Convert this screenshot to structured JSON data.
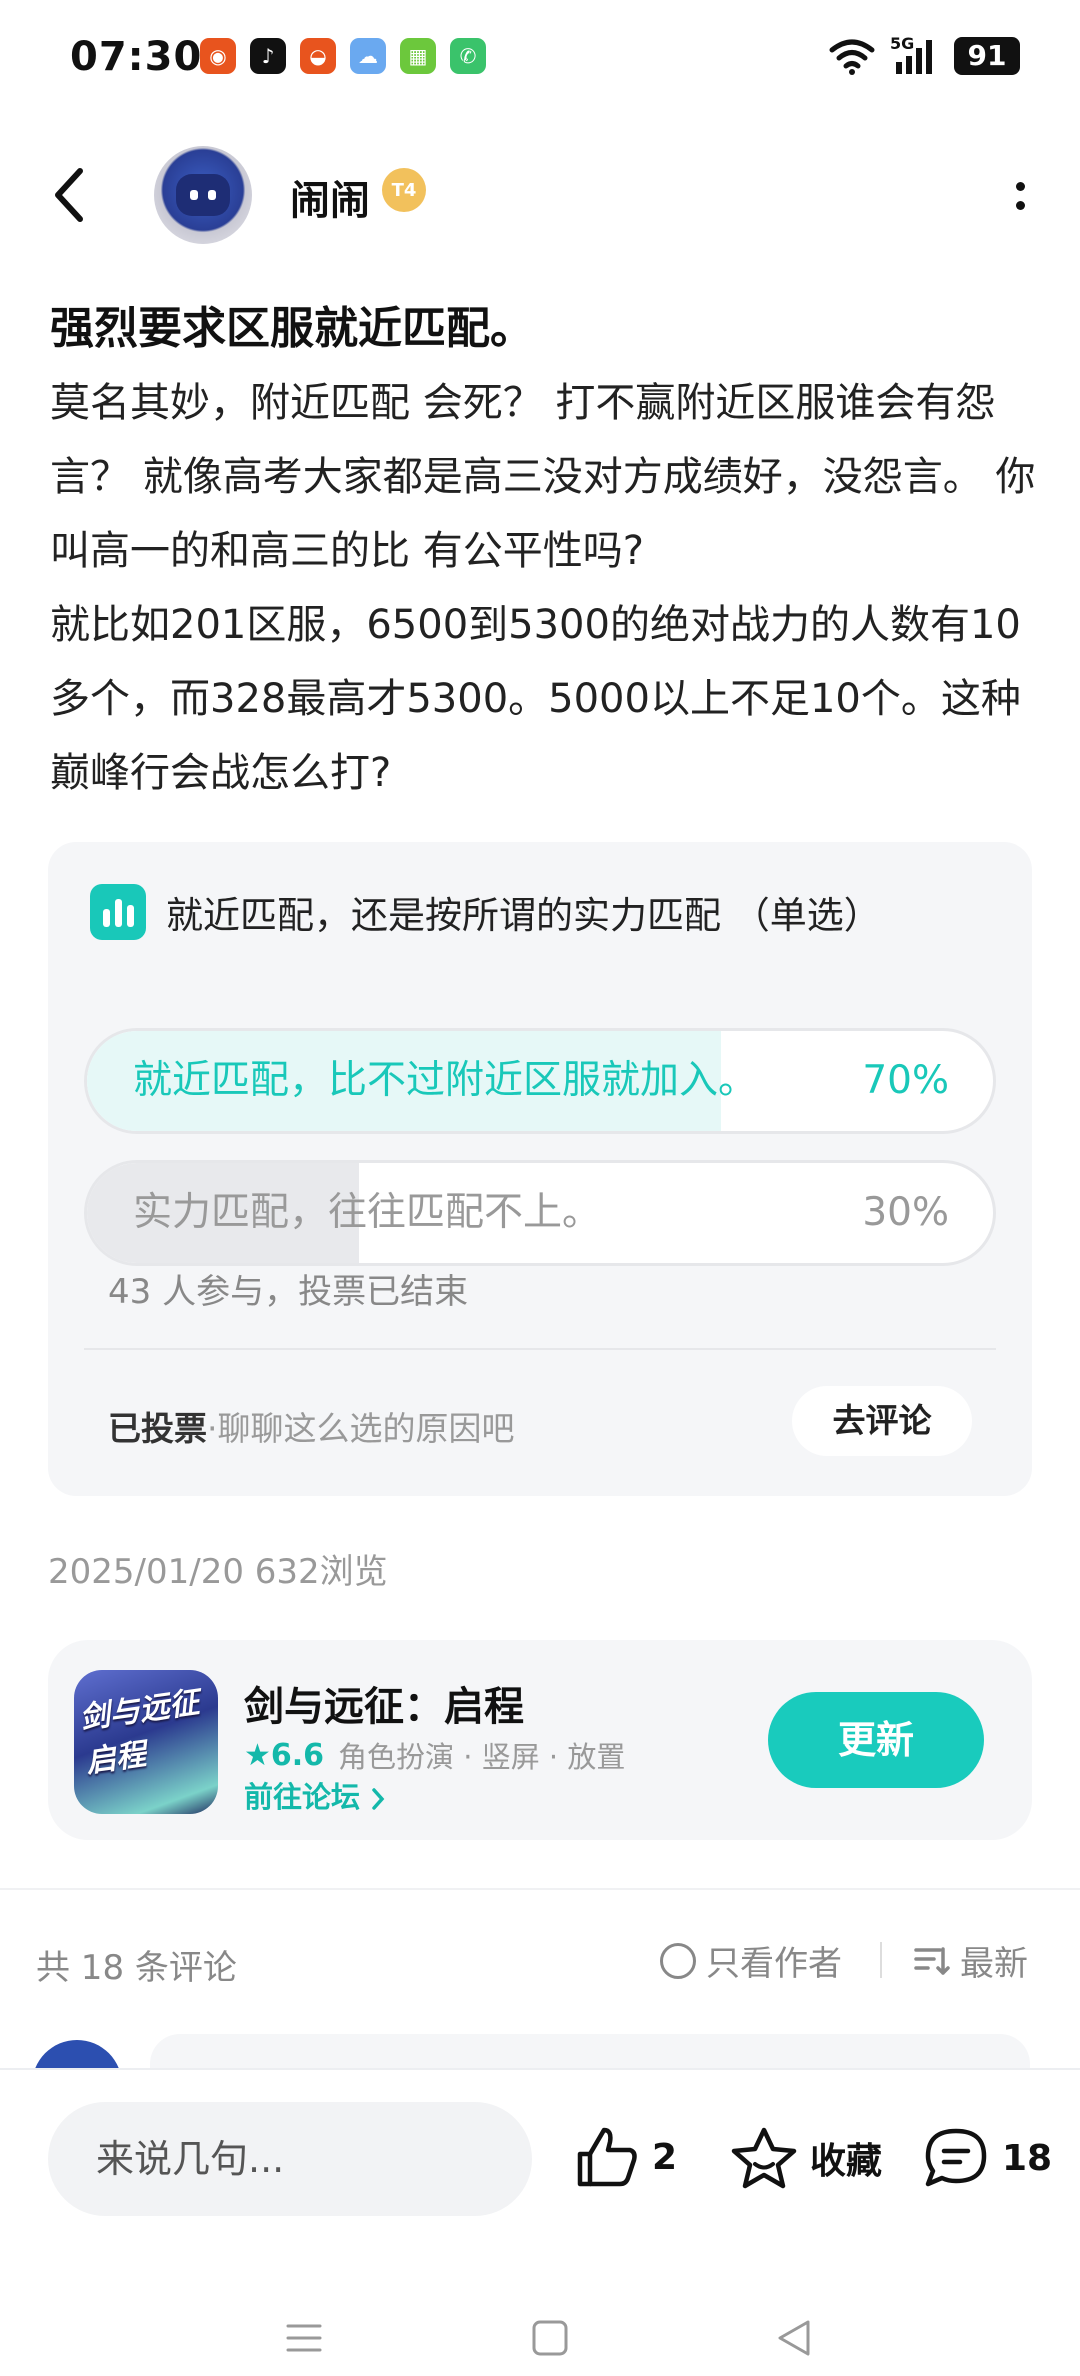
{
  "status_bar": {
    "time": "07:30",
    "network": "5G",
    "battery": "91",
    "notification_icons": [
      {
        "name": "weibo-icon",
        "color": "#e8541e",
        "glyph": "◉"
      },
      {
        "name": "tiktok-icon",
        "color": "#111111",
        "glyph": "♪"
      },
      {
        "name": "app-icon",
        "color": "#e8541e",
        "glyph": "◒"
      },
      {
        "name": "weather-icon",
        "color": "#6aa9f0",
        "glyph": "☁"
      },
      {
        "name": "app-icon",
        "color": "#6cc83c",
        "glyph": "▦"
      },
      {
        "name": "phone-icon",
        "color": "#3ac36b",
        "glyph": "✆"
      }
    ]
  },
  "header": {
    "username": "闹闹",
    "level_badge": "T4"
  },
  "post": {
    "title": "强烈要求区服就近匹配。",
    "paragraphs": [
      "莫名其妙，附近匹配 会死？ 打不赢附近区服谁会有怨言？ 就像高考大家都是高三没对方成绩好，没怨言。 你叫高一的和高三的比 有公平性吗?",
      "就比如201区服，6500到5300的绝对战力的人数有10多个，而328最高才5300。5000以上不足10个。这种巅峰行会战怎么打?"
    ]
  },
  "poll": {
    "question": "就近匹配，还是按所谓的实力匹配 （单选）",
    "options": [
      {
        "label": "就近匹配，比不过附近区服就加入。",
        "percent_text": "70%",
        "percent": 70,
        "selected": true
      },
      {
        "label": "实力匹配，往往匹配不上。",
        "percent_text": "30%",
        "percent": 30,
        "selected": false
      }
    ],
    "participants": "43 人参与，投票已结束",
    "voted_label": "已投票",
    "voted_hint": "·聊聊这么选的原因吧",
    "comment_button": "去评论",
    "colors": {
      "accent": "#19c8b9",
      "selected_fill": "#e6f8f7",
      "other_fill": "#e8e9ec"
    }
  },
  "post_meta": "2025/01/20  632浏览",
  "game": {
    "icon_text": "剑与远征启程",
    "name": "剑与远征：启程",
    "rating": "★6.6",
    "tags": "角色扮演 · 竖屏 · 放置",
    "forum_link": "前往论坛 ",
    "update_button": "更新"
  },
  "comments": {
    "count": "共 18 条评论",
    "author_only": "只看作者",
    "sort": "最新"
  },
  "bottom_bar": {
    "input_placeholder": "来说几句...",
    "like_count": "2",
    "favorite_label": "收藏",
    "comment_count": "18"
  }
}
